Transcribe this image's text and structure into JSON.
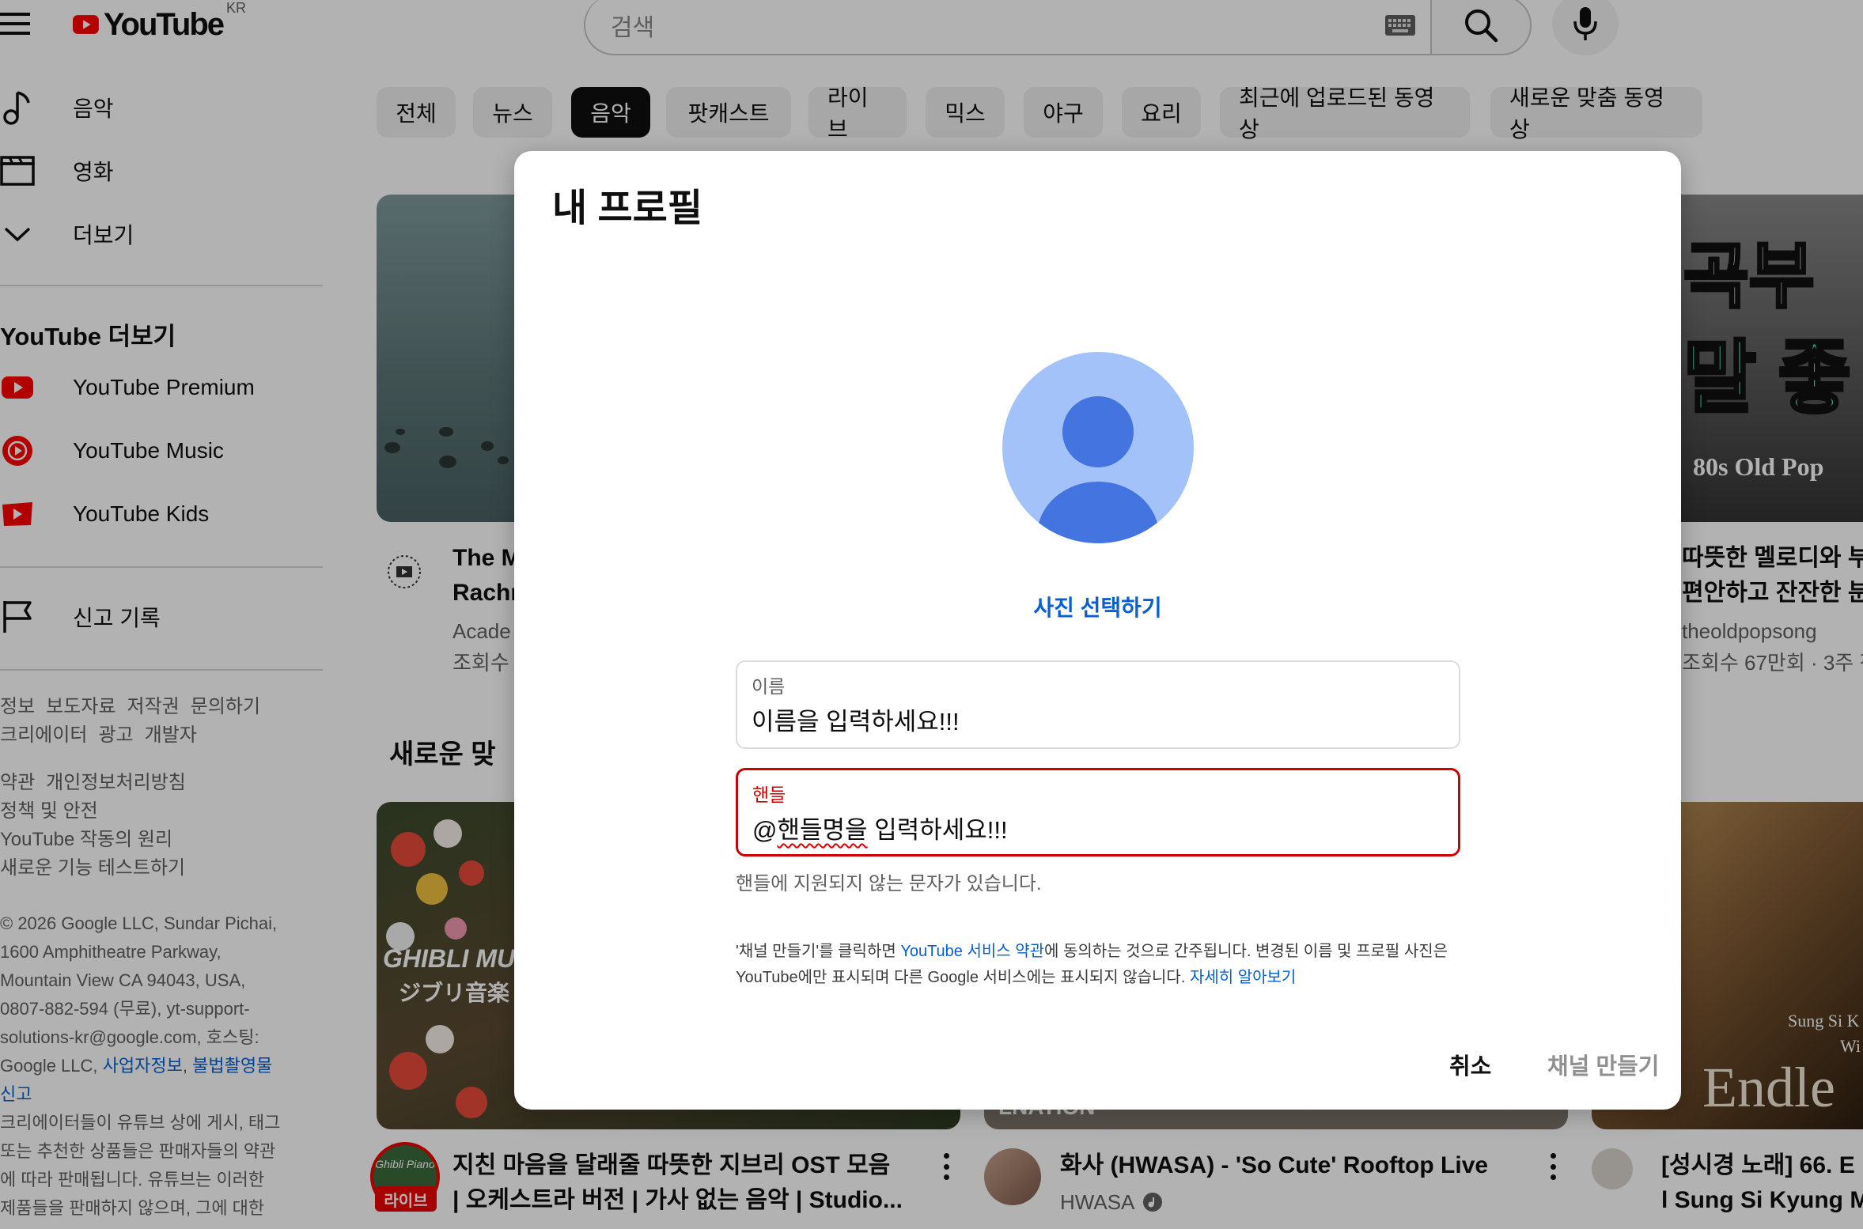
{
  "header": {
    "logo_text": "YouTube",
    "country_code": "KR",
    "search_placeholder": "검색"
  },
  "sidebar": {
    "items": [
      {
        "label": "음악",
        "icon": "music-note-icon"
      },
      {
        "label": "영화",
        "icon": "clapperboard-icon"
      },
      {
        "label": "더보기",
        "icon": "chevron-down-icon"
      }
    ],
    "more_heading": "YouTube 더보기",
    "products": [
      {
        "label": "YouTube Premium",
        "icon": "youtube-premium-icon"
      },
      {
        "label": "YouTube Music",
        "icon": "youtube-music-icon"
      },
      {
        "label": "YouTube Kids",
        "icon": "youtube-kids-icon"
      }
    ],
    "report_history": "신고 기록",
    "footer_row1": [
      "정보",
      "보도자료",
      "저작권",
      "문의하기"
    ],
    "footer_row2": [
      "크리에이터",
      "광고",
      "개발자"
    ],
    "footer_row3": [
      "약관",
      "개인정보처리방침"
    ],
    "footer_row4": "정책 및 안전",
    "footer_row5": "YouTube 작동의 원리",
    "footer_row6": "새로운 기능 테스트하기",
    "copyright_lines": [
      "© 2026 Google LLC, Sundar Pichai,",
      "1600 Amphitheatre Parkway,",
      "Mountain View CA 94043, USA,",
      "0807-882-594 (무료), yt-support-",
      "solutions-kr@google.com, 호스팅:"
    ],
    "copyright_tail": "Google LLC,",
    "biz_info_link": "사업자정보",
    "illegal_link": "불법촬영물",
    "report_link": "신고",
    "disclaimer_lines": [
      "크리에이터들이 유튜브 상에 게시, 태그",
      "또는 추천한 상품들은 판매자들의 약관",
      "에 따라 판매됩니다. 유튜브는 이러한",
      "제품들을 판매하지 않으며, 그에 대한"
    ]
  },
  "chips": [
    "전체",
    "뉴스",
    "음악",
    "팟캐스트",
    "라이브",
    "믹스",
    "야구",
    "요리",
    "최근에 업로드된 동영상",
    "새로운 맞춤 동영상"
  ],
  "active_chip": "음악",
  "content": {
    "video1": {
      "title_line1": "The M",
      "title_line2": "Rachn",
      "channel": "Acade",
      "views": "조회수"
    },
    "video2": {
      "title_line1": "따뜻한 멜로디와 부",
      "title_line2": "편안하고 잔잔한 분",
      "channel": "theoldpopsong",
      "views": "조회수 67만회 · 3주 전",
      "thumb_text_top": "곡부",
      "thumb_text_mid": "말 좋",
      "thumb_text_bottom": "80s Old Pop"
    },
    "section_title": "새로운 맞",
    "video3": {
      "title_line1": "지친 마음을 달래줄 따뜻한 지브리 OST 모음",
      "title_line2": "| 오케스트라 버전 | 가사 없는 음악 | Studio...",
      "live_badge": "라이브",
      "thumb_text": "GHIBLI MUSIC",
      "thumb_text2": "ジブリ音楽",
      "avatar_text": "Ghibli Piano"
    },
    "video4": {
      "title": "화사 (HWASA) - 'So Cute' Rooftop Live",
      "channel": "HWASA",
      "thumb_text": "LNATION"
    },
    "video5": {
      "title_line1": "[성시경 노래] 66. E",
      "title_line2": "l Sung Si Kyung M",
      "thumb_text1": "Sung Si K",
      "thumb_text2": "Wi",
      "thumb_text3": "Endle"
    }
  },
  "dialog": {
    "title": "내 프로필",
    "select_photo": "사진 선택하기",
    "name_label": "이름",
    "name_value": "이름을 입력하세요!!!",
    "handle_label": "핸들",
    "handle_prefix": "@",
    "handle_value_misspelled": "핸들명을",
    "handle_value_rest": " 입력하세요!!!",
    "handle_error": "핸들에 지원되지 않는 문자가 있습니다.",
    "terms_part1": "'채널 만들기'를 클릭하면 ",
    "terms_link": "YouTube 서비스 약관",
    "terms_part2": "에 동의하는 것으로 간주됩니다. 변경된 이름 및 프로필 사진은",
    "terms_line2": "YouTube에만 표시되며 다른 Google 서비스에는 표시되지 않습니다. ",
    "learn_more": "자세히 알아보기",
    "cancel": "취소",
    "create_channel": "채널 만들기"
  },
  "colors": {
    "brand_red": "#ff0000",
    "link_blue": "#065fd4",
    "error_red": "#cc0000",
    "avatar_light": "#a3c2fa",
    "avatar_dark": "#4374e0"
  }
}
